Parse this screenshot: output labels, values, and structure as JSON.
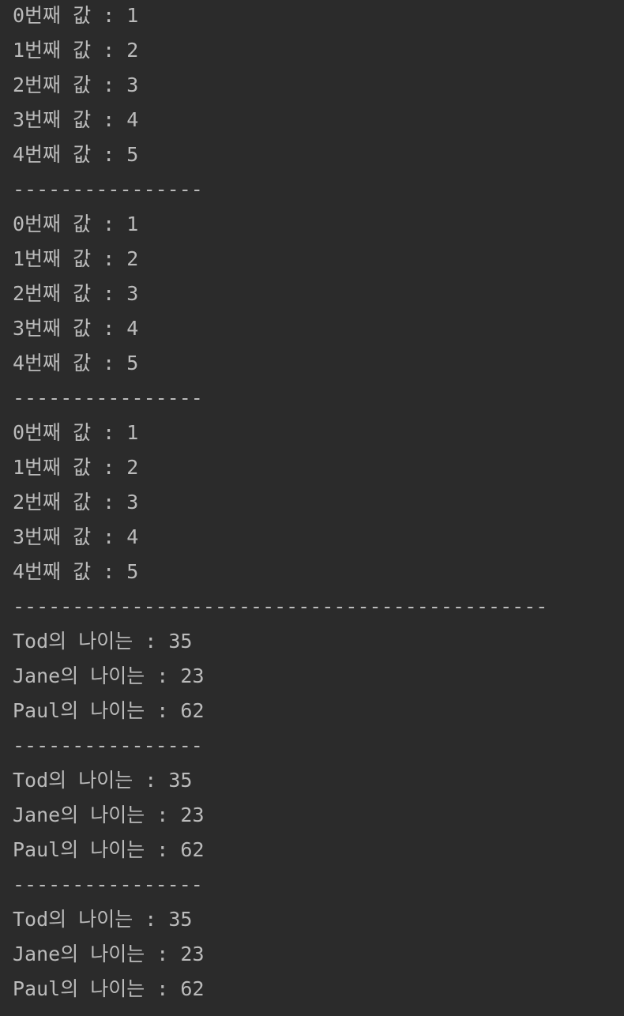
{
  "console": {
    "lines": [
      "0번째 값 : 1",
      "1번째 값 : 2",
      "2번째 값 : 3",
      "3번째 값 : 4",
      "4번째 값 : 5",
      "----------------",
      "0번째 값 : 1",
      "1번째 값 : 2",
      "2번째 값 : 3",
      "3번째 값 : 4",
      "4번째 값 : 5",
      "----------------",
      "0번째 값 : 1",
      "1번째 값 : 2",
      "2번째 값 : 3",
      "3번째 값 : 4",
      "4번째 값 : 5",
      "---------------------------------------------",
      "Tod의 나이는 : 35",
      "Jane의 나이는 : 23",
      "Paul의 나이는 : 62",
      "----------------",
      "Tod의 나이는 : 35",
      "Jane의 나이는 : 23",
      "Paul의 나이는 : 62",
      "----------------",
      "Tod의 나이는 : 35",
      "Jane의 나이는 : 23",
      "Paul의 나이는 : 62"
    ]
  },
  "colors": {
    "background": "#2b2b2b",
    "text": "#bbbbbb"
  }
}
